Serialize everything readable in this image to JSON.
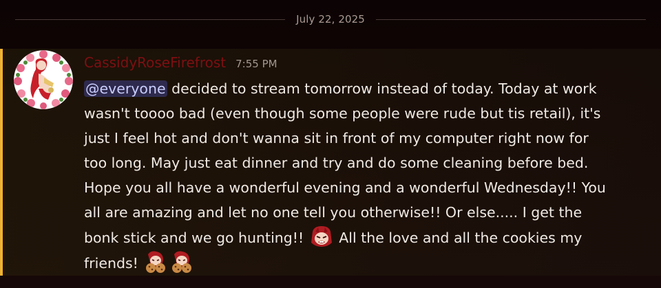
{
  "date_divider": "July 22, 2025",
  "message": {
    "username": "CassidyRoseFirefrost",
    "timestamp": "7:55 PM",
    "mention": "@everyone",
    "lines": [
      "decided to stream tomorrow instead of today. Today at work",
      "wasn't toooo bad (even though some people were rude but tis retail), it's",
      "just I feel hot and don't wanna sit in front of my computer right now for",
      "too long. May just eat dinner and try and do some cleaning before bed.",
      "Hope you all have a wonderful evening and a wonderful Wednesday!! You",
      "all are amazing and let no one tell you otherwise!! Or else..... I get the",
      "bonk stick and we go hunting!!",
      "All the love and all the cookies my",
      "friends!"
    ],
    "emojis": {
      "bonk": "angry-girl-emoji",
      "cookie": "cookie-girl-emoji"
    },
    "colors": {
      "username": "#7e0f12",
      "mention_bar": "#f0b232",
      "mention_bg": "#5865f2"
    }
  }
}
